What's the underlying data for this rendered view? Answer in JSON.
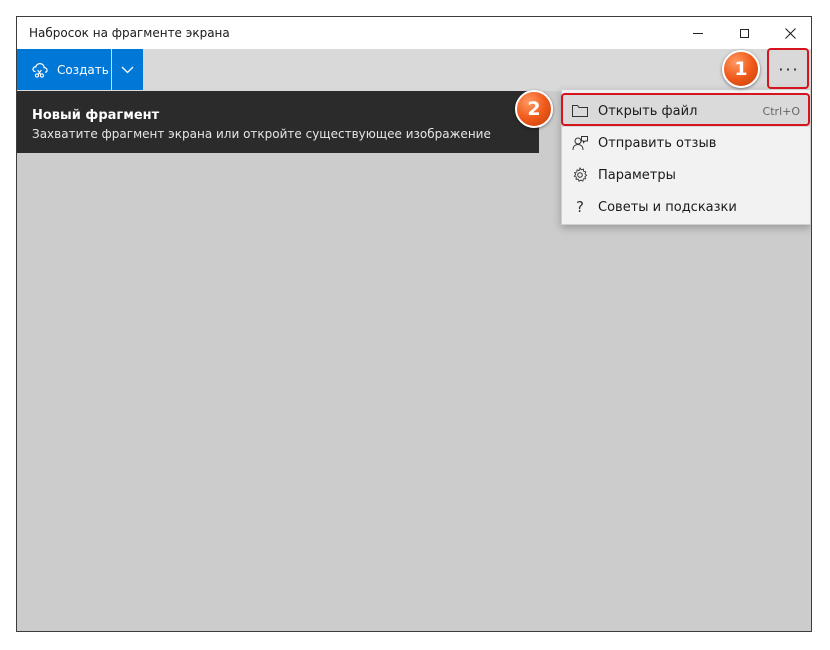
{
  "window": {
    "title": "Набросок на фрагменте экрана"
  },
  "toolbar": {
    "create_label": "Создать",
    "more_label": "···"
  },
  "tooltip": {
    "title": "Новый фрагмент",
    "description": "Захватите фрагмент экрана или откройте существующее изображение"
  },
  "menu": {
    "items": [
      {
        "label": "Открыть файл",
        "shortcut": "Ctrl+O",
        "icon": "folder-icon"
      },
      {
        "label": "Отправить отзыв",
        "shortcut": "",
        "icon": "feedback-icon"
      },
      {
        "label": "Параметры",
        "shortcut": "",
        "icon": "gear-icon"
      },
      {
        "label": "Советы и подсказки",
        "shortcut": "",
        "icon": "question-icon"
      }
    ]
  },
  "annotations": {
    "step1": "1",
    "step2": "2"
  },
  "colors": {
    "accent": "#0078d7",
    "highlight": "#d6141d",
    "badge": "#f05a1a",
    "tooltip_bg": "#2b2b2b",
    "canvas_bg": "#cccccc"
  }
}
